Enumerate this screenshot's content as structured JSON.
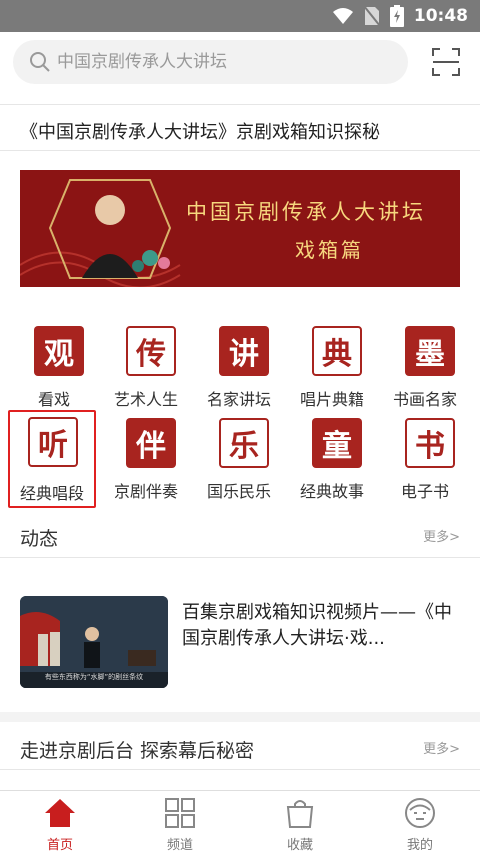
{
  "status_bar": {
    "time": "10:48"
  },
  "search": {
    "placeholder": "中国京剧传承人大讲坛"
  },
  "headline": "《中国京剧传承人大讲坛》京剧戏箱知识探秘",
  "banner": {
    "title": "中国京剧传承人大讲坛",
    "subtitle": "戏箱篇"
  },
  "categories": [
    {
      "seal": "观",
      "label": "看戏",
      "style": "solid"
    },
    {
      "seal": "传",
      "label": "艺术人生",
      "style": "outline"
    },
    {
      "seal": "讲",
      "label": "名家讲坛",
      "style": "solid"
    },
    {
      "seal": "典",
      "label": "唱片典籍",
      "style": "outline"
    },
    {
      "seal": "墨",
      "label": "书画名家",
      "style": "solid"
    },
    {
      "seal": "听",
      "label": "经典唱段",
      "style": "outline",
      "selected": true
    },
    {
      "seal": "伴",
      "label": "京剧伴奏",
      "style": "solid"
    },
    {
      "seal": "乐",
      "label": "国乐民乐",
      "style": "outline"
    },
    {
      "seal": "童",
      "label": "经典故事",
      "style": "solid"
    },
    {
      "seal": "书",
      "label": "电子书",
      "style": "outline"
    }
  ],
  "dynamics": {
    "title": "动态",
    "more": "更多>",
    "item": {
      "title": "百集京剧戏箱知识视频片——《中国京剧传承人大讲坛·戏...",
      "thumb_caption": "有些东西称为“水脚”的剧丝条纹"
    }
  },
  "backstage": {
    "title": "走进京剧后台 探索幕后秘密",
    "more": "更多>"
  },
  "tabs": [
    {
      "label": "首页",
      "icon": "home-icon",
      "active": true
    },
    {
      "label": "频道",
      "icon": "grid-icon"
    },
    {
      "label": "收藏",
      "icon": "bag-icon"
    },
    {
      "label": "我的",
      "icon": "profile-icon"
    }
  ],
  "colors": {
    "accent": "#c81e1e",
    "banner_bg": "#8b1414",
    "banner_text": "#f7d77e",
    "seal_red": "#a8241f"
  }
}
